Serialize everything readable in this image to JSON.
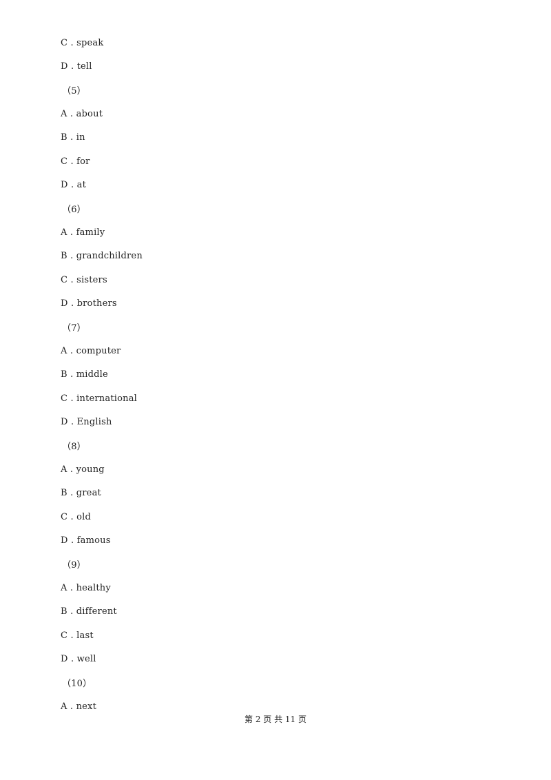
{
  "lines": [
    {
      "type": "option",
      "text": "C . speak"
    },
    {
      "type": "option",
      "text": "D . tell"
    },
    {
      "type": "question",
      "text": "（5）"
    },
    {
      "type": "option",
      "text": "A . about"
    },
    {
      "type": "option",
      "text": "B . in"
    },
    {
      "type": "option",
      "text": "C . for"
    },
    {
      "type": "option",
      "text": "D . at"
    },
    {
      "type": "question",
      "text": "（6）"
    },
    {
      "type": "option",
      "text": "A . family"
    },
    {
      "type": "option",
      "text": "B . grandchildren"
    },
    {
      "type": "option",
      "text": "C . sisters"
    },
    {
      "type": "option",
      "text": "D . brothers"
    },
    {
      "type": "question",
      "text": "（7）"
    },
    {
      "type": "option",
      "text": "A . computer"
    },
    {
      "type": "option",
      "text": "B . middle"
    },
    {
      "type": "option",
      "text": "C . international"
    },
    {
      "type": "option",
      "text": "D . English"
    },
    {
      "type": "question",
      "text": "（8）"
    },
    {
      "type": "option",
      "text": "A . young"
    },
    {
      "type": "option",
      "text": "B . great"
    },
    {
      "type": "option",
      "text": "C . old"
    },
    {
      "type": "option",
      "text": "D . famous"
    },
    {
      "type": "question",
      "text": "（9）"
    },
    {
      "type": "option",
      "text": "A . healthy"
    },
    {
      "type": "option",
      "text": "B . different"
    },
    {
      "type": "option",
      "text": "C . last"
    },
    {
      "type": "option",
      "text": "D . well"
    },
    {
      "type": "question",
      "text": "（10）"
    },
    {
      "type": "option",
      "text": "A . next"
    }
  ],
  "footer": {
    "text": "第 2 页 共 11 页"
  }
}
